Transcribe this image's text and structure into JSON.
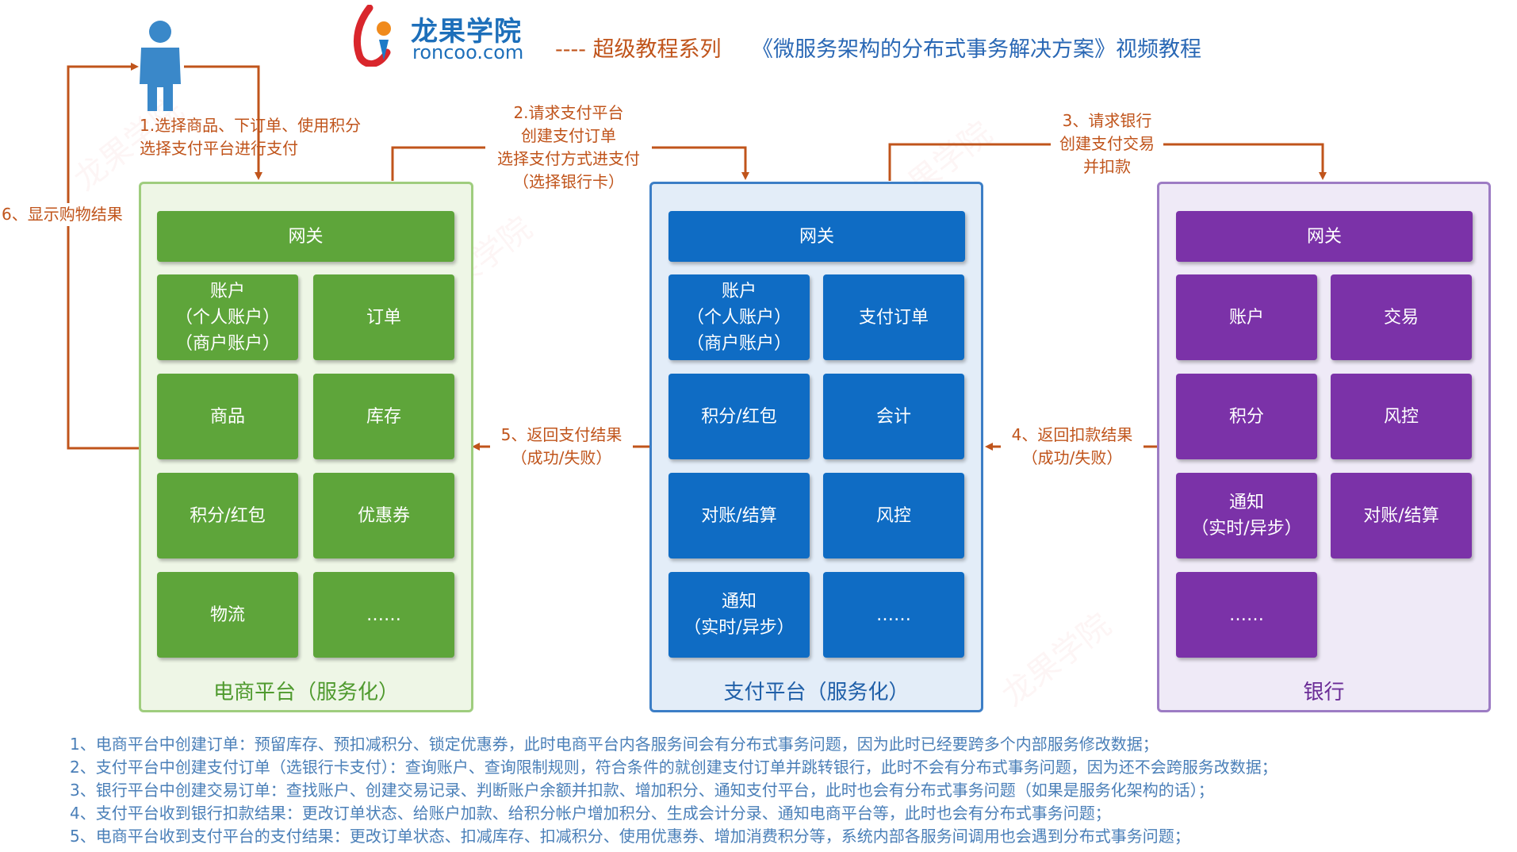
{
  "logo": {
    "name_cn": "龙果学院",
    "domain": "roncoo.com"
  },
  "header": {
    "series": "---- 超级教程系列",
    "course": "《微服务架构的分布式事务解决方案》视频教程"
  },
  "user_icon": "person-icon",
  "steps": {
    "s1": [
      "1.选择商品、下订单、使用积分",
      "选择支付平台进行支付"
    ],
    "s2": [
      "2.请求支付平台",
      "创建支付订单",
      "选择支付方式进支付",
      "（选择银行卡）"
    ],
    "s3": [
      "3、请求银行",
      "创建支付交易",
      "并扣款"
    ],
    "s4": [
      "4、返回扣款结果",
      "（成功/失败）"
    ],
    "s5": [
      "5、返回支付结果",
      "（成功/失败）"
    ],
    "s6": "6、显示购物结果"
  },
  "platforms": {
    "ecommerce": {
      "label": "电商平台（服务化）",
      "gateway": "网关",
      "tiles": [
        "账户\n（个人账户）\n（商户账户）",
        "订单",
        "商品",
        "库存",
        "积分/红包",
        "优惠券",
        "物流",
        "……"
      ]
    },
    "payment": {
      "label": "支付平台（服务化）",
      "gateway": "网关",
      "tiles": [
        "账户\n（个人账户）\n（商户账户）",
        "支付订单",
        "积分/红包",
        "会计",
        "对账/结算",
        "风控",
        "通知\n（实时/异步）",
        "……"
      ]
    },
    "bank": {
      "label": "银行",
      "gateway": "网关",
      "tiles": [
        "账户",
        "交易",
        "积分",
        "风控",
        "通知\n（实时/异步）",
        "对账/结算",
        "……"
      ]
    }
  },
  "notes": [
    "1、电商平台中创建订单：预留库存、预扣减积分、锁定优惠券，此时电商平台内各服务间会有分布式事务问题，因为此时已经要跨多个内部服务修改数据；",
    "2、支付平台中创建支付订单（选银行卡支付）：查询账户、查询限制规则，符合条件的就创建支付订单并跳转银行，此时不会有分布式事务问题，因为还不会跨服务改数据；",
    "3、银行平台中创建交易订单：查找账户、创建交易记录、判断账户余额并扣款、增加积分、通知支付平台，此时也会有分布式事务问题（如果是服务化架构的话）；",
    "4、支付平台收到银行扣款结果：更改订单状态、给账户加款、给积分帐户增加积分、生成会计分录、通知电商平台等，此时也会有分布式事务问题；",
    "5、电商平台收到支付平台的支付结果：更改订单状态、扣减库存、扣减积分、使用优惠券、增加消费积分等，系统内部各服务间调用也会遇到分布式事务问题；"
  ],
  "colors": {
    "arrow": "#c0541b",
    "ecommerce_tile": "#5ea53a",
    "ecommerce_bg": "#eef6e6",
    "payment_tile": "#0f6cc4",
    "payment_bg": "#e3edf8",
    "bank_tile": "#7b32a8",
    "bank_bg": "#efeaf7",
    "notes": "#4a7fb8"
  }
}
